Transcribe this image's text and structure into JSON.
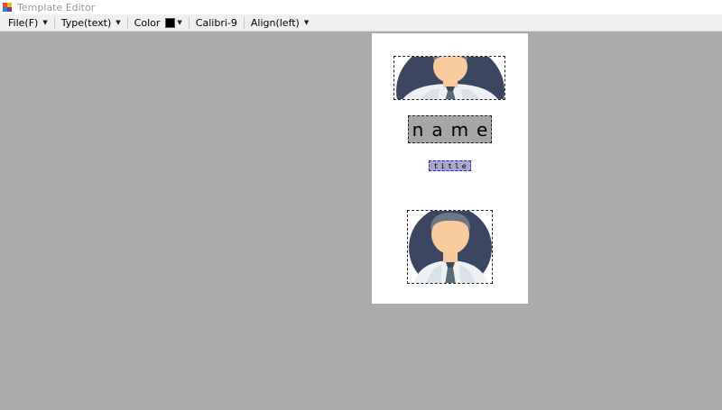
{
  "window": {
    "title": "Template Editor",
    "icon": "app-icon"
  },
  "toolbar": {
    "file_label": "File(F)",
    "type_label": "Type(text)",
    "color_label": "Color",
    "color_value": "#000000",
    "font_label": "Calibri-9",
    "align_label": "Align(left)"
  },
  "canvas": {
    "background": "#ababab",
    "page_background": "#ffffff",
    "elements": {
      "top_image": {
        "kind": "image",
        "icon": "person-avatar-icon"
      },
      "name_field": {
        "kind": "text",
        "text": "name",
        "background": "#a6a6a6"
      },
      "title_field": {
        "kind": "text",
        "text": "title",
        "background": "#a9a9c9",
        "selected": true
      },
      "bottom_image": {
        "kind": "image",
        "icon": "person-avatar-icon"
      }
    }
  }
}
